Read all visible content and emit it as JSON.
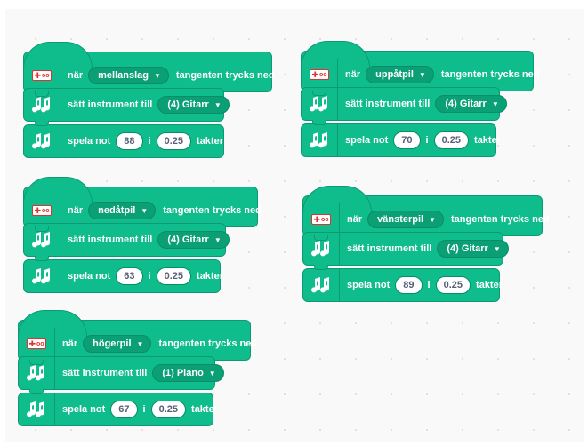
{
  "scripts": [
    {
      "when_label": "när",
      "key": "mellanslag",
      "pressed_label": "tangenten trycks ned",
      "set_label": "sätt instrument till",
      "instrument": "(4) Gitarr",
      "play_label": "spela not",
      "note": "88",
      "in_label": "i",
      "beats": "0.25",
      "beats_label": "takter"
    },
    {
      "when_label": "när",
      "key": "uppåtpil",
      "pressed_label": "tangenten trycks ned",
      "set_label": "sätt instrument till",
      "instrument": "(4) Gitarr",
      "play_label": "spela not",
      "note": "70",
      "in_label": "i",
      "beats": "0.25",
      "beats_label": "takter"
    },
    {
      "when_label": "när",
      "key": "nedåtpil",
      "pressed_label": "tangenten trycks ned",
      "set_label": "sätt instrument till",
      "instrument": "(4) Gitarr",
      "play_label": "spela not",
      "note": "63",
      "in_label": "i",
      "beats": "0.25",
      "beats_label": "takter"
    },
    {
      "when_label": "när",
      "key": "vänsterpil",
      "pressed_label": "tangenten trycks ned",
      "set_label": "sätt instrument till",
      "instrument": "(4) Gitarr",
      "play_label": "spela not",
      "note": "89",
      "in_label": "i",
      "beats": "0.25",
      "beats_label": "takter"
    },
    {
      "when_label": "när",
      "key": "högerpil",
      "pressed_label": "tangenten trycks ned",
      "set_label": "sätt instrument till",
      "instrument": "(1) Piano",
      "play_label": "spela not",
      "note": "67",
      "in_label": "i",
      "beats": "0.25",
      "beats_label": "takter"
    }
  ],
  "colors": {
    "block_fill": "#0fbd8c",
    "block_border": "#0b9a72",
    "workspace_bg": "#f9f9f9",
    "icon_red": "#dd3333"
  },
  "icons": {
    "hat": "ev3-brick-icon",
    "instrument": "music-notes-icon",
    "play": "music-notes-icon",
    "dropdown": "caret-down-icon"
  }
}
